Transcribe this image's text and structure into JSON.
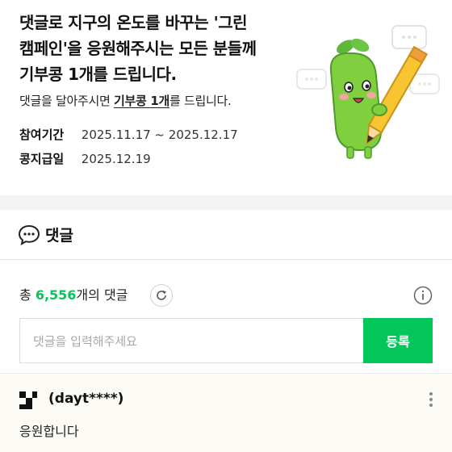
{
  "banner": {
    "headline_line1": "댓글로 지구의 온도를 바꾸는 '그린",
    "headline_line2": "캠페인'을 응원해주시는 모든 분들께",
    "headline_line3": "기부콩 1개를 드립니다.",
    "sub_prefix": "댓글을 달아주시면 ",
    "sub_highlight": "기부콩 1개",
    "sub_suffix": "를 드립니다.",
    "period_label": "참여기간",
    "period_value": "2025.11.17 ~ 2025.12.17",
    "pay_label": "콩지급일",
    "pay_value": "2025.12.19"
  },
  "comments": {
    "title": "댓글",
    "count_prefix": "총 ",
    "count_value": "6,556",
    "count_suffix": "개의 댓글",
    "input_placeholder": "댓글을 입력해주세요",
    "submit_label": "등록",
    "items": [
      {
        "author": "(dayt****)",
        "text": "응원합니다"
      }
    ]
  },
  "colors": {
    "accent": "#03c75a",
    "mascot_green": "#7fcf3f",
    "pencil_yellow": "#f6c531"
  }
}
